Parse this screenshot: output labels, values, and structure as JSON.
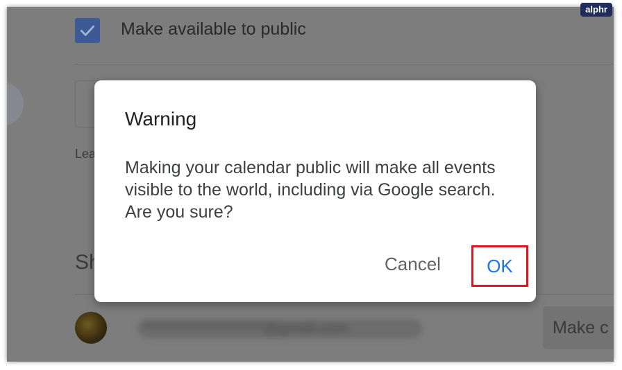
{
  "settings": {
    "public_checkbox_checked": true,
    "public_label": "Make available to public",
    "learn_fragment": "Lea",
    "share_heading_fragment": "Sh",
    "share_row": {
      "email_blurred": "********************@gmail.com",
      "button_fragment": "Make c"
    }
  },
  "dialog": {
    "title": "Warning",
    "body": "Making your calendar public will make all events visible to the world, including via Google search. Are you sure?",
    "cancel_label": "Cancel",
    "ok_label": "OK"
  },
  "logo": {
    "text": "alphr"
  },
  "colors": {
    "overlay": "#7d7d7d",
    "checkbox": "#3d5a94",
    "ok_text": "#1a73e8",
    "highlight_border": "#e0161f",
    "logo_bg": "#1f2c5c"
  }
}
